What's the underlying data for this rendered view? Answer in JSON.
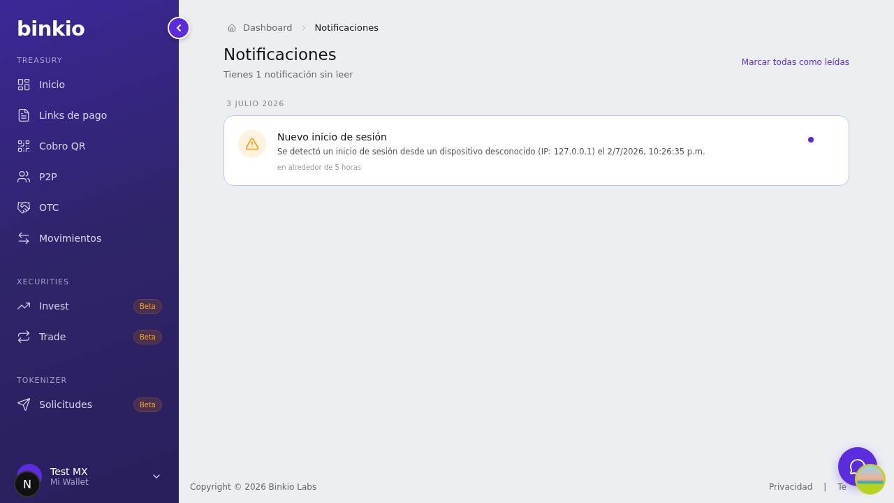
{
  "sidebar": {
    "logo": "binkio",
    "sections": [
      {
        "title": "TREASURY",
        "items": [
          {
            "label": "Inicio"
          },
          {
            "label": "Links de pago"
          },
          {
            "label": "Cobro QR"
          },
          {
            "label": "P2P"
          },
          {
            "label": "OTC"
          },
          {
            "label": "Movimientos"
          }
        ]
      },
      {
        "title": "XECURITIES",
        "items": [
          {
            "label": "Invest",
            "badge": "Beta"
          },
          {
            "label": "Trade",
            "badge": "Beta"
          }
        ]
      },
      {
        "title": "TOKENIZER",
        "items": [
          {
            "label": "Solicitudes",
            "badge": "Beta"
          }
        ]
      }
    ],
    "user": {
      "name": "Test MX",
      "subtitle": "Mi Wallet"
    },
    "dev_badge": "N"
  },
  "breadcrumb": [
    "Dashboard",
    "Notificaciones"
  ],
  "page": {
    "title": "Notificaciones",
    "subtitle": "Tienes 1 notificación sin leer",
    "action": "Marcar todas como leídas"
  },
  "groups": [
    {
      "date": "3 JULIO 2026",
      "notifications": [
        {
          "title": "Nuevo inicio de sesión",
          "message": "Se detectó un inicio de sesión desde un dispositivo desconocido (IP: 127.0.0.1) el 2/7/2026, 10:26:35 p.m.",
          "time": "en alrededor de 5 horas",
          "unread": true
        }
      ]
    }
  ],
  "footer": {
    "copyright": "Copyright © 2026 Binkio Labs",
    "links": [
      "Privacidad",
      "Te"
    ],
    "separator": "|"
  }
}
